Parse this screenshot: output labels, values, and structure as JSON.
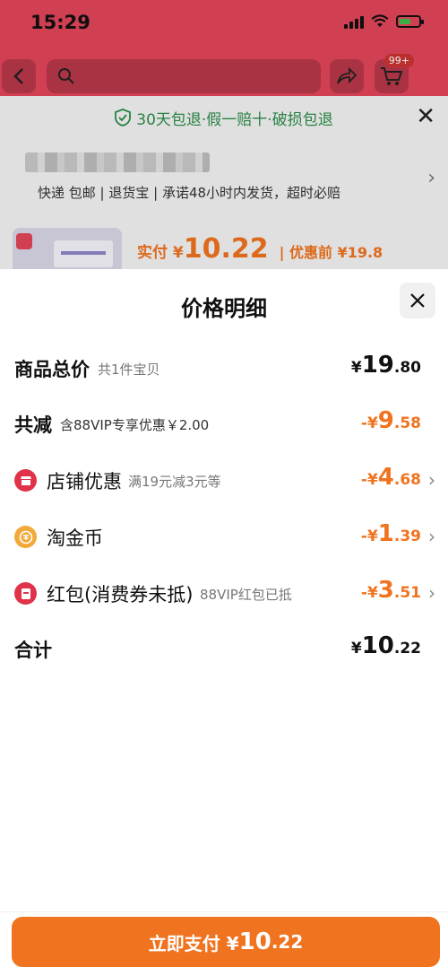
{
  "status_bar": {
    "time": "15:29"
  },
  "nav": {
    "cart_badge": "99+"
  },
  "background": {
    "promise_text": "30天包退·假一赔十·破损包退",
    "shop_tags": "快递 包邮 | 退货宝 | 承诺48小时内发货，超时必赔",
    "pay_prefix": "实付 ¥",
    "pay_amount": "10.22",
    "before_label": "| 优惠前 ¥19.8"
  },
  "sheet": {
    "title": "价格明细",
    "rows": [
      {
        "label": "商品总价",
        "sub": "共1件宝贝",
        "yen": "¥",
        "int": "19",
        "dec": ".80"
      },
      {
        "label": "共减",
        "sub": "含88VIP专享优惠￥2.00",
        "yen": "-¥",
        "int": "9",
        "dec": ".58"
      },
      {
        "label": "店铺优惠",
        "sub": "满19元减3元等",
        "yen": "-¥",
        "int": "4",
        "dec": ".68"
      },
      {
        "label": "淘金币",
        "sub": "",
        "yen": "-¥",
        "int": "1",
        "dec": ".39"
      },
      {
        "label": "红包(消费券未抵)",
        "sub": "88VIP红包已抵",
        "yen": "-¥",
        "int": "3",
        "dec": ".51"
      },
      {
        "label": "合计",
        "sub": "",
        "yen": "¥",
        "int": "10",
        "dec": ".22"
      }
    ],
    "icons": {
      "shop": "shop-coupon-icon",
      "coin": "taojinbi-coin-icon",
      "redpacket": "red-packet-icon"
    }
  },
  "pay_button": {
    "label": "立即支付 ¥",
    "int": "10",
    "dec": ".22"
  },
  "colors": {
    "accent": "#f0731f",
    "header": "#e2455a",
    "green": "#2c8d4a"
  }
}
